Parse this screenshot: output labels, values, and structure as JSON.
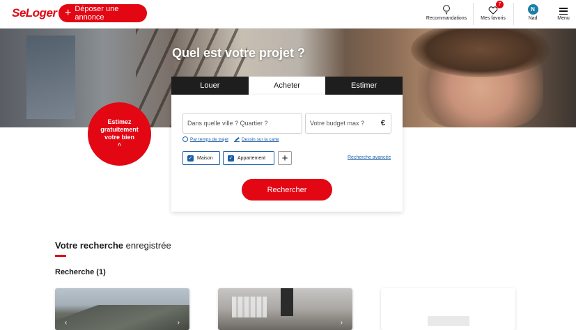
{
  "header": {
    "logo": "SeLoger",
    "post_button_label": "Déposer une annonce",
    "recommendations_label": "Recommandations",
    "favorites_label": "Mes favoris",
    "favorites_count": "7",
    "user_initial": "N",
    "user_name": "Nad",
    "menu_label": "Menu"
  },
  "hero": {
    "title": "Quel est votre projet ?",
    "estimate_line1": "Estimez",
    "estimate_line2": "gratuitement",
    "estimate_line3": "votre bien",
    "estimate_chevron": "^"
  },
  "search": {
    "tabs": [
      {
        "label": "Louer",
        "active": false
      },
      {
        "label": "Acheter",
        "active": true
      },
      {
        "label": "Estimer",
        "active": false
      }
    ],
    "city_placeholder": "Dans quelle ville ? Quartier ?",
    "budget_placeholder": "Votre budget max ?",
    "currency": "€",
    "link_travel_time": "Par temps de trajet",
    "link_map_drawing": "Dessin sur la carte",
    "chip_house": "Maison",
    "chip_apartment": "Appartement",
    "add_type": "+",
    "advanced_search": "Recherche avancée",
    "submit_label": "Rechercher"
  },
  "saved": {
    "title_bold": "Votre recherche",
    "title_rest": " enregistrée",
    "subtitle": "Recherche (1)"
  },
  "colors": {
    "brand_red": "#e30613",
    "link_blue": "#1b5fa6",
    "avatar_blue": "#1b7fa6"
  }
}
